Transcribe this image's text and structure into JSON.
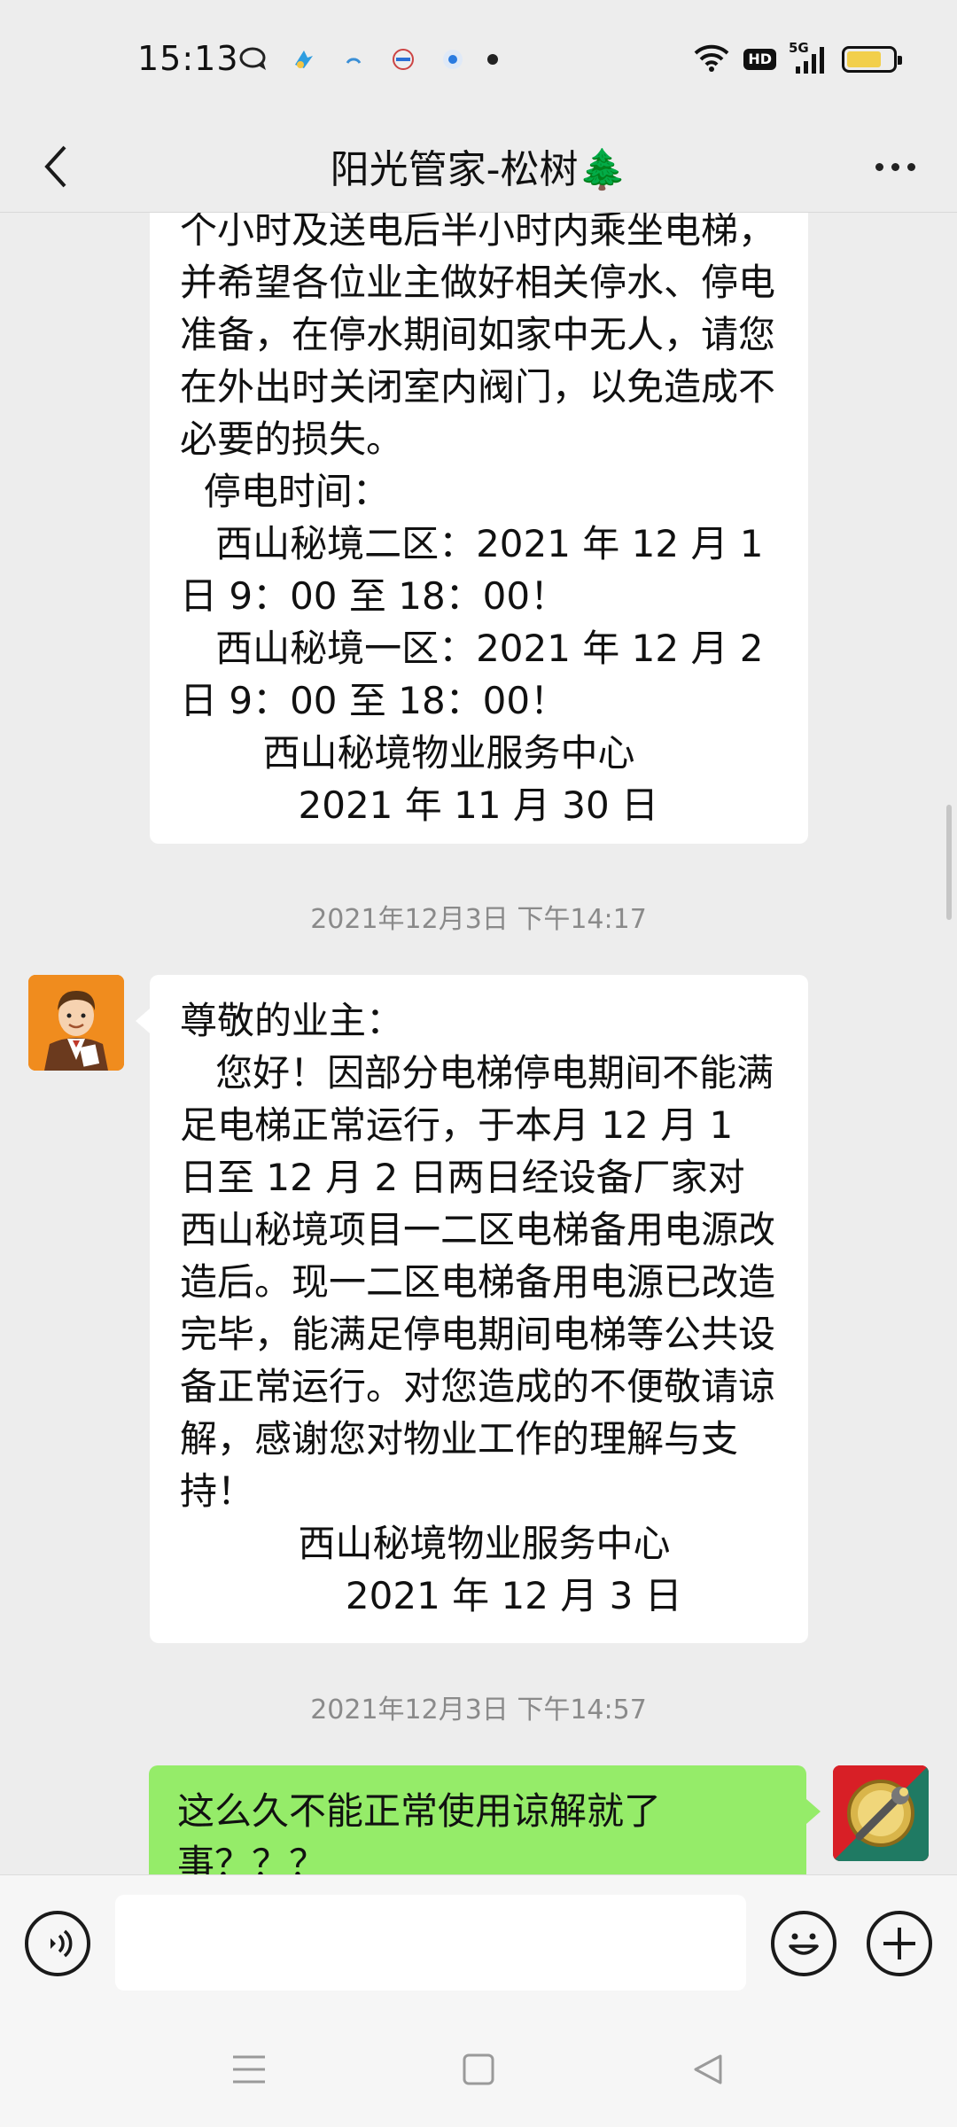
{
  "status_bar": {
    "time": "15:13",
    "icons": [
      "chat-bubble-icon",
      "app-icon",
      "app-icon",
      "app-icon",
      "app-icon",
      "notification-dot-icon"
    ],
    "right_icons": [
      "wifi-icon",
      "hd-icon",
      "signal-5g-icon",
      "battery-icon"
    ],
    "hd_label": "HD",
    "network_label": "5G",
    "battery_level": 0.75
  },
  "header": {
    "title": "阳光管家-松树🌲"
  },
  "messages": [
    {
      "sender": "other",
      "text": "个小时及送电后半小时内乘坐电梯，并希望各位业主做好相关停水、停电准备，在停水期间如家中无人，请您在外出时关闭室内阀门，以免造成不必要的损失。\n  停电时间：\n   西山秘境二区：2021 年 12 月 1 日 9：00 至 18：00！\n   西山秘境一区：2021 年 12 月 2 日 9：00 至 18：00！\n       西山秘境物业服务中心\n          2021 年 11 月 30 日"
    },
    {
      "timestamp": "2021年12月3日 下午14:17"
    },
    {
      "sender": "other",
      "text": "尊敬的业主：\n   您好！因部分电梯停电期间不能满足电梯正常运行，于本月 12 月 1 日至 12 月 2 日两日经设备厂家对西山秘境项目一二区电梯备用电源改造后。现一二区电梯备用电源已改造完毕，能满足停电期间电梯等公共设备正常运行。对您造成的不便敬请谅解，感谢您对物业工作的理解与支持！\n          西山秘境物业服务中心\n              2021 年 12 月 3 日"
    },
    {
      "timestamp": "2021年12月3日 下午14:57"
    },
    {
      "sender": "self",
      "text": "这么久不能正常使用谅解就了事？？？"
    }
  ],
  "input_bar": {
    "placeholder": "",
    "value": ""
  },
  "colors": {
    "background": "#ededed",
    "self_bubble": "#95ec69",
    "other_bubble": "#ffffff"
  }
}
